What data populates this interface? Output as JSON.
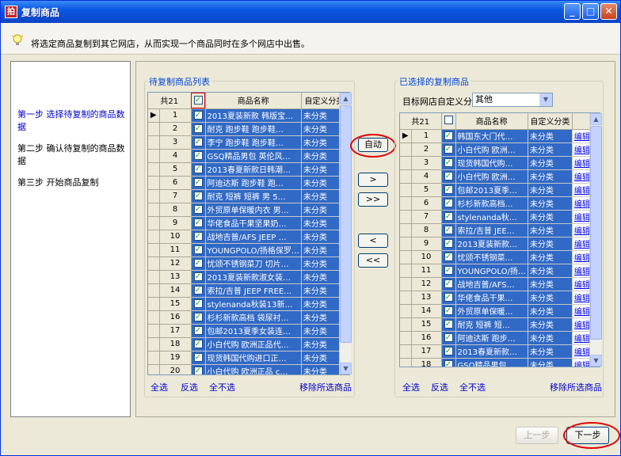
{
  "window": {
    "title": "复制商品",
    "app_icon": "拍"
  },
  "hint": "将选定商品复制到其它网店，从而实现一个商品同时在多个网店中出售。",
  "steps": [
    {
      "label": "第一步  选择待复制的商品数据",
      "active": true
    },
    {
      "label": "第二步  确认待复制的商品数据",
      "active": false
    },
    {
      "label": "第三步  开始商品复制",
      "active": false
    }
  ],
  "left_panel": {
    "title": "待复制商品列表",
    "columns": [
      "共21",
      "",
      "商品名称",
      "自定义分类"
    ],
    "rows": [
      {
        "num": "1",
        "name": "2013夏装新款 韩版宝…",
        "category": "未分类"
      },
      {
        "num": "2",
        "name": "耐克 跑步鞋 跑步鞋…",
        "category": "未分类"
      },
      {
        "num": "3",
        "name": "李宁 跑步鞋 跑步鞋…",
        "category": "未分类"
      },
      {
        "num": "4",
        "name": "GSQ精品男包 英伦风…",
        "category": "未分类"
      },
      {
        "num": "5",
        "name": "2013春夏新款日韩潮…",
        "category": "未分类"
      },
      {
        "num": "6",
        "name": "阿迪达斯 跑步鞋 跑…",
        "category": "未分类"
      },
      {
        "num": "7",
        "name": "耐克 短裤 短裤 男 5…",
        "category": "未分类"
      },
      {
        "num": "8",
        "name": "外贸原单保暖内衣 男…",
        "category": "未分类"
      },
      {
        "num": "9",
        "name": "华佬食品干果坚果奶…",
        "category": "未分类"
      },
      {
        "num": "10",
        "name": "战地吉普/AFS JEEP …",
        "category": "未分类"
      },
      {
        "num": "11",
        "name": "YOUNGPOLO/扬格保罗…",
        "category": "未分类"
      },
      {
        "num": "12",
        "name": "忧颂不锈钢菜刀 切片…",
        "category": "未分类"
      },
      {
        "num": "13",
        "name": "2013夏装新款淑女装…",
        "category": "未分类"
      },
      {
        "num": "14",
        "name": "索拉/吉普 JEEP FREE…",
        "category": "未分类"
      },
      {
        "num": "15",
        "name": "stylenanda秋装13新…",
        "category": "未分类"
      },
      {
        "num": "16",
        "name": "杉杉新款高档 袋尿衬…",
        "category": "未分类"
      },
      {
        "num": "17",
        "name": "包邮2013夏季女装连…",
        "category": "未分类"
      },
      {
        "num": "18",
        "name": "小白代购 欧洲正品代…",
        "category": "未分类"
      },
      {
        "num": "19",
        "name": "现货韩国代购进口正…",
        "category": "未分类"
      },
      {
        "num": "20",
        "name": "小白代购 欧洲正品 c…",
        "category": "未分类"
      }
    ],
    "select_all": "全选",
    "invert": "反选",
    "select_none": "全不选",
    "remove_selected": "移除所选商品"
  },
  "middle": {
    "auto": "自动",
    "move_right": ">",
    "move_all_right": ">>",
    "move_left": "<",
    "move_all_left": "<<"
  },
  "right_panel": {
    "title": "已选择的复制商品",
    "shop_category_label": "目标网店自定义分类",
    "shop_category_value": "其他",
    "columns": [
      "共21",
      "",
      "商品名称",
      "自定义分类",
      ""
    ],
    "edit_label": "编辑",
    "rows": [
      {
        "num": "1",
        "name": "韩国东大门代…",
        "category": "未分类"
      },
      {
        "num": "2",
        "name": "小白代购 欧洲…",
        "category": "未分类"
      },
      {
        "num": "3",
        "name": "现货韩国代购…",
        "category": "未分类"
      },
      {
        "num": "4",
        "name": "小白代购 欧洲…",
        "category": "未分类"
      },
      {
        "num": "5",
        "name": "包邮2013夏季…",
        "category": "未分类"
      },
      {
        "num": "6",
        "name": "杉杉新款高档…",
        "category": "未分类"
      },
      {
        "num": "7",
        "name": "stylenanda秋…",
        "category": "未分类"
      },
      {
        "num": "8",
        "name": "索拉/吉普 JEE…",
        "category": "未分类"
      },
      {
        "num": "9",
        "name": "2013夏装新款…",
        "category": "未分类"
      },
      {
        "num": "10",
        "name": "忧颂不锈钢菜…",
        "category": "未分类"
      },
      {
        "num": "11",
        "name": "YOUNGPOLO/扬…",
        "category": "未分类"
      },
      {
        "num": "12",
        "name": "战地吉普/AFS…",
        "category": "未分类"
      },
      {
        "num": "13",
        "name": "华佬食品干果…",
        "category": "未分类"
      },
      {
        "num": "14",
        "name": "外贸原单保暖…",
        "category": "未分类"
      },
      {
        "num": "15",
        "name": "耐克 短裤 短…",
        "category": "未分类"
      },
      {
        "num": "16",
        "name": "阿迪达斯 跑步…",
        "category": "未分类"
      },
      {
        "num": "17",
        "name": "2013春夏新款…",
        "category": "未分类"
      },
      {
        "num": "18",
        "name": "GSQ精品男包…",
        "category": "未分类"
      }
    ],
    "select_all": "全选",
    "invert": "反选",
    "select_none": "全不选",
    "remove_selected": "移除所选商品"
  },
  "footer": {
    "prev": "上一步",
    "next": "下一步"
  }
}
